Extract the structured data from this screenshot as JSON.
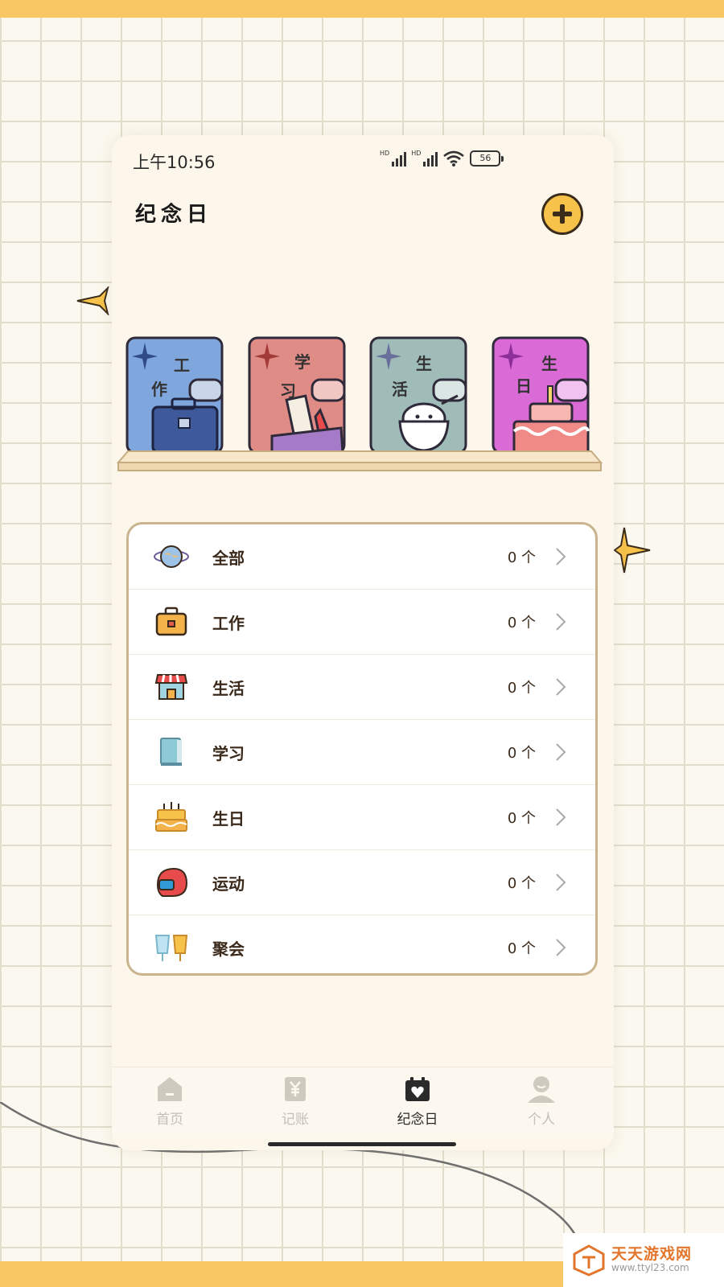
{
  "status_bar": {
    "time": "上午10:56",
    "net_1": "HD",
    "net_2": "HD",
    "battery": "56"
  },
  "header": {
    "title": "纪念日",
    "add_icon": "plus-circle-icon"
  },
  "bookshelf": {
    "books": [
      {
        "chars": [
          "工",
          "作"
        ],
        "color": "#7fa6dd"
      },
      {
        "chars": [
          "学",
          "习"
        ],
        "color": "#e08c86"
      },
      {
        "chars": [
          "生",
          "活"
        ],
        "color": "#9fbcb8"
      },
      {
        "chars": [
          "生",
          "日"
        ],
        "color": "#da6ad6"
      }
    ]
  },
  "categories": [
    {
      "label": "全部",
      "count": "0 个",
      "icon": "globe-icon"
    },
    {
      "label": "工作",
      "count": "0 个",
      "icon": "briefcase-icon"
    },
    {
      "label": "生活",
      "count": "0 个",
      "icon": "shop-icon"
    },
    {
      "label": "学习",
      "count": "0 个",
      "icon": "book-icon"
    },
    {
      "label": "生日",
      "count": "0 个",
      "icon": "cake-icon"
    },
    {
      "label": "运动",
      "count": "0 个",
      "icon": "helmet-icon"
    },
    {
      "label": "聚会",
      "count": "0 个",
      "icon": "drinks-icon"
    }
  ],
  "tabs": [
    {
      "label": "首页",
      "icon": "home-icon",
      "active": false
    },
    {
      "label": "记账",
      "icon": "yen-note-icon",
      "active": false
    },
    {
      "label": "纪念日",
      "icon": "calendar-heart-icon",
      "active": true
    },
    {
      "label": "个人",
      "icon": "person-icon",
      "active": false
    }
  ],
  "watermark": {
    "name": "天天游戏网",
    "url": "www.ttyl23.com"
  },
  "colors": {
    "accent_yellow": "#f6c24a",
    "frame_yellow": "#f9c865",
    "card_border": "#c9b48e",
    "text_brown": "#3b2a1b"
  }
}
